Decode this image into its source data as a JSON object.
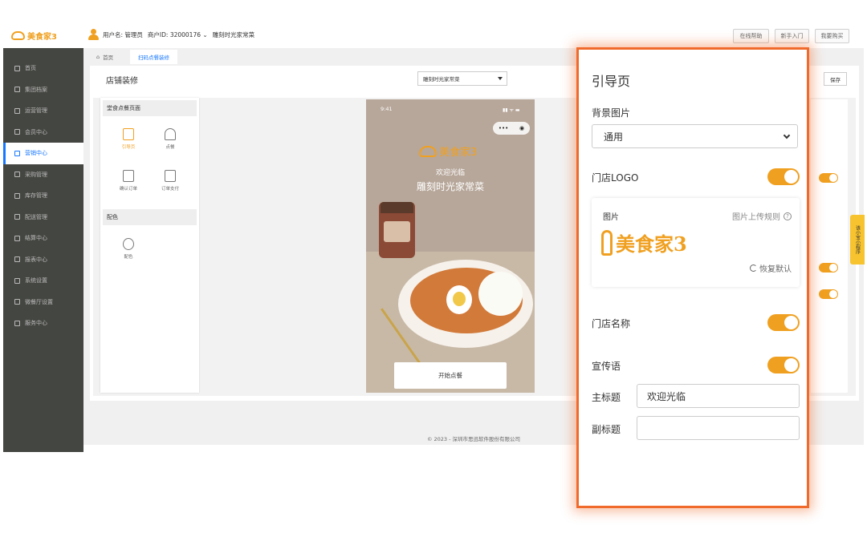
{
  "header": {
    "brand": "美食家3",
    "user_label": "用户名: 管理员",
    "merchant_label": "商户ID: 32000176 ⌄",
    "store_name": "雕刻时光家常菜",
    "buttons": [
      "在线帮助",
      "新手入门",
      "我要购买"
    ]
  },
  "sidebar": {
    "items": [
      {
        "label": "首页",
        "icon": "home-icon"
      },
      {
        "label": "集团档案",
        "icon": "file-icon"
      },
      {
        "label": "运营管理",
        "icon": "chart-icon"
      },
      {
        "label": "会员中心",
        "icon": "card-icon"
      },
      {
        "label": "营销中心",
        "icon": "edit-icon"
      },
      {
        "label": "采购管理",
        "icon": "cart-icon"
      },
      {
        "label": "库存管理",
        "icon": "box-icon"
      },
      {
        "label": "配送管理",
        "icon": "truck-icon"
      },
      {
        "label": "结算中心",
        "icon": "coin-icon"
      },
      {
        "label": "报表中心",
        "icon": "report-icon"
      },
      {
        "label": "系统设置",
        "icon": "gear-icon"
      },
      {
        "label": "微餐厅设置",
        "icon": "fork-icon"
      },
      {
        "label": "服务中心",
        "icon": "service-icon"
      }
    ],
    "active_index": 4
  },
  "tabs": [
    {
      "label": "首页"
    },
    {
      "label": "扫码点餐装修"
    }
  ],
  "page": {
    "title": "店铺装修",
    "store_select": "雕刻时光家常菜",
    "save_label": "保存"
  },
  "left_panel": {
    "section1": "堂食点餐页面",
    "items1": [
      {
        "label": "引导页",
        "icon": "guide-page-icon"
      },
      {
        "label": "点餐",
        "icon": "dish-cover-icon"
      },
      {
        "label": "确认订单",
        "icon": "order-confirm-icon"
      },
      {
        "label": "订单支付",
        "icon": "wallet-icon"
      }
    ],
    "section2": "配色",
    "items2": [
      {
        "label": "配色",
        "icon": "palette-icon"
      }
    ]
  },
  "phone": {
    "time": "9:41",
    "status": "▮▮ ᯤ ▬",
    "capsule_dots": "•••",
    "capsule_close": "◉",
    "brand": "美食家3",
    "welcome": "欢迎光临",
    "store": "雕刻时光家常菜",
    "start_button": "开始点餐"
  },
  "side_tag": "该小宝小程序",
  "footer": "© 2023 - 深圳市思迅软件股份有限公司",
  "overlay": {
    "title": "引导页",
    "bg_image_label": "背景图片",
    "bg_image_value": "通用",
    "logo_label": "门店LOGO",
    "logo_card_label": "图片",
    "upload_rule": "图片上传规则",
    "help": "?",
    "logo_text": "美食家3",
    "restore": "恢复默认",
    "store_name_label": "门店名称",
    "slogan_label": "宣传语",
    "main_title_label": "主标题",
    "main_title_value": "欢迎光临",
    "sub_title_label": "副标题",
    "sub_title_value": ""
  },
  "colors": {
    "accent": "#f0a020",
    "highlight_border": "#f06a2b",
    "sidebar_bg": "#444641",
    "active_blue": "#1677ff"
  }
}
